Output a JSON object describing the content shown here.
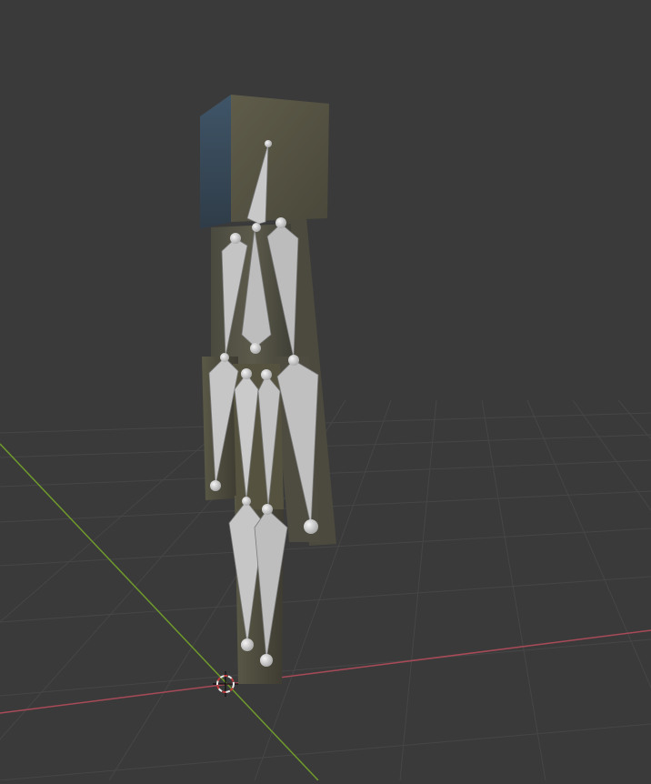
{
  "viewport": {
    "view": "3D Viewport",
    "object": "character-mesh",
    "armature": "armature",
    "colors": {
      "background": "#3a3a3a",
      "grid_line": "#4a4a4a",
      "x_axis": "#b0465a",
      "y_axis": "#6f9a2c",
      "bone": "#b4b4b4",
      "bone_dark": "#8a8a8a",
      "joint": "#dcdcdc",
      "mesh_light": "#6e6a58",
      "mesh_dark": "#3a4a5a",
      "cursor_ring": "#e8e8e8",
      "cursor_accent": "#c23b3b"
    },
    "icons": [
      "3d-cursor-icon"
    ]
  }
}
